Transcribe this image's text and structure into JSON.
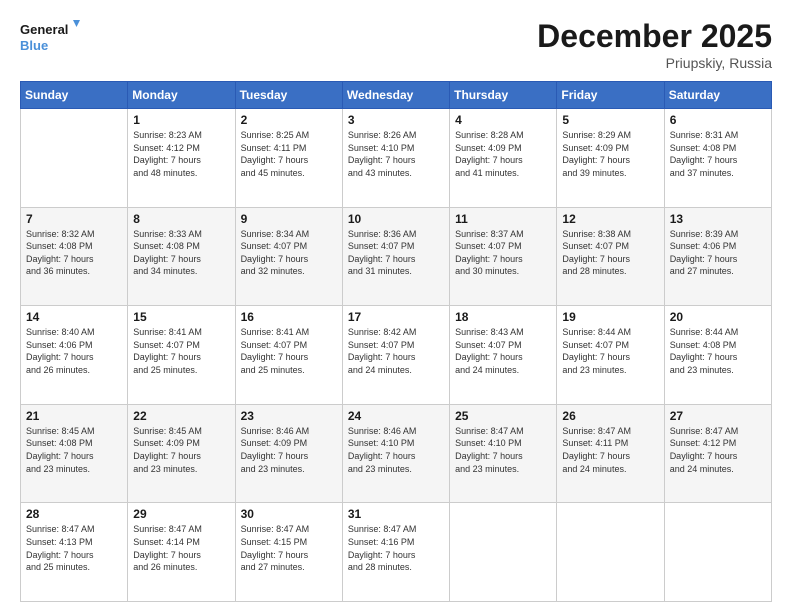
{
  "logo": {
    "line1": "General",
    "line2": "Blue"
  },
  "header": {
    "month": "December 2025",
    "location": "Priupskiy, Russia"
  },
  "columns": [
    "Sunday",
    "Monday",
    "Tuesday",
    "Wednesday",
    "Thursday",
    "Friday",
    "Saturday"
  ],
  "weeks": [
    [
      {
        "day": "",
        "info": ""
      },
      {
        "day": "1",
        "info": "Sunrise: 8:23 AM\nSunset: 4:12 PM\nDaylight: 7 hours\nand 48 minutes."
      },
      {
        "day": "2",
        "info": "Sunrise: 8:25 AM\nSunset: 4:11 PM\nDaylight: 7 hours\nand 45 minutes."
      },
      {
        "day": "3",
        "info": "Sunrise: 8:26 AM\nSunset: 4:10 PM\nDaylight: 7 hours\nand 43 minutes."
      },
      {
        "day": "4",
        "info": "Sunrise: 8:28 AM\nSunset: 4:09 PM\nDaylight: 7 hours\nand 41 minutes."
      },
      {
        "day": "5",
        "info": "Sunrise: 8:29 AM\nSunset: 4:09 PM\nDaylight: 7 hours\nand 39 minutes."
      },
      {
        "day": "6",
        "info": "Sunrise: 8:31 AM\nSunset: 4:08 PM\nDaylight: 7 hours\nand 37 minutes."
      }
    ],
    [
      {
        "day": "7",
        "info": "Sunrise: 8:32 AM\nSunset: 4:08 PM\nDaylight: 7 hours\nand 36 minutes."
      },
      {
        "day": "8",
        "info": "Sunrise: 8:33 AM\nSunset: 4:08 PM\nDaylight: 7 hours\nand 34 minutes."
      },
      {
        "day": "9",
        "info": "Sunrise: 8:34 AM\nSunset: 4:07 PM\nDaylight: 7 hours\nand 32 minutes."
      },
      {
        "day": "10",
        "info": "Sunrise: 8:36 AM\nSunset: 4:07 PM\nDaylight: 7 hours\nand 31 minutes."
      },
      {
        "day": "11",
        "info": "Sunrise: 8:37 AM\nSunset: 4:07 PM\nDaylight: 7 hours\nand 30 minutes."
      },
      {
        "day": "12",
        "info": "Sunrise: 8:38 AM\nSunset: 4:07 PM\nDaylight: 7 hours\nand 28 minutes."
      },
      {
        "day": "13",
        "info": "Sunrise: 8:39 AM\nSunset: 4:06 PM\nDaylight: 7 hours\nand 27 minutes."
      }
    ],
    [
      {
        "day": "14",
        "info": "Sunrise: 8:40 AM\nSunset: 4:06 PM\nDaylight: 7 hours\nand 26 minutes."
      },
      {
        "day": "15",
        "info": "Sunrise: 8:41 AM\nSunset: 4:07 PM\nDaylight: 7 hours\nand 25 minutes."
      },
      {
        "day": "16",
        "info": "Sunrise: 8:41 AM\nSunset: 4:07 PM\nDaylight: 7 hours\nand 25 minutes."
      },
      {
        "day": "17",
        "info": "Sunrise: 8:42 AM\nSunset: 4:07 PM\nDaylight: 7 hours\nand 24 minutes."
      },
      {
        "day": "18",
        "info": "Sunrise: 8:43 AM\nSunset: 4:07 PM\nDaylight: 7 hours\nand 24 minutes."
      },
      {
        "day": "19",
        "info": "Sunrise: 8:44 AM\nSunset: 4:07 PM\nDaylight: 7 hours\nand 23 minutes."
      },
      {
        "day": "20",
        "info": "Sunrise: 8:44 AM\nSunset: 4:08 PM\nDaylight: 7 hours\nand 23 minutes."
      }
    ],
    [
      {
        "day": "21",
        "info": "Sunrise: 8:45 AM\nSunset: 4:08 PM\nDaylight: 7 hours\nand 23 minutes."
      },
      {
        "day": "22",
        "info": "Sunrise: 8:45 AM\nSunset: 4:09 PM\nDaylight: 7 hours\nand 23 minutes."
      },
      {
        "day": "23",
        "info": "Sunrise: 8:46 AM\nSunset: 4:09 PM\nDaylight: 7 hours\nand 23 minutes."
      },
      {
        "day": "24",
        "info": "Sunrise: 8:46 AM\nSunset: 4:10 PM\nDaylight: 7 hours\nand 23 minutes."
      },
      {
        "day": "25",
        "info": "Sunrise: 8:47 AM\nSunset: 4:10 PM\nDaylight: 7 hours\nand 23 minutes."
      },
      {
        "day": "26",
        "info": "Sunrise: 8:47 AM\nSunset: 4:11 PM\nDaylight: 7 hours\nand 24 minutes."
      },
      {
        "day": "27",
        "info": "Sunrise: 8:47 AM\nSunset: 4:12 PM\nDaylight: 7 hours\nand 24 minutes."
      }
    ],
    [
      {
        "day": "28",
        "info": "Sunrise: 8:47 AM\nSunset: 4:13 PM\nDaylight: 7 hours\nand 25 minutes."
      },
      {
        "day": "29",
        "info": "Sunrise: 8:47 AM\nSunset: 4:14 PM\nDaylight: 7 hours\nand 26 minutes."
      },
      {
        "day": "30",
        "info": "Sunrise: 8:47 AM\nSunset: 4:15 PM\nDaylight: 7 hours\nand 27 minutes."
      },
      {
        "day": "31",
        "info": "Sunrise: 8:47 AM\nSunset: 4:16 PM\nDaylight: 7 hours\nand 28 minutes."
      },
      {
        "day": "",
        "info": ""
      },
      {
        "day": "",
        "info": ""
      },
      {
        "day": "",
        "info": ""
      }
    ]
  ]
}
